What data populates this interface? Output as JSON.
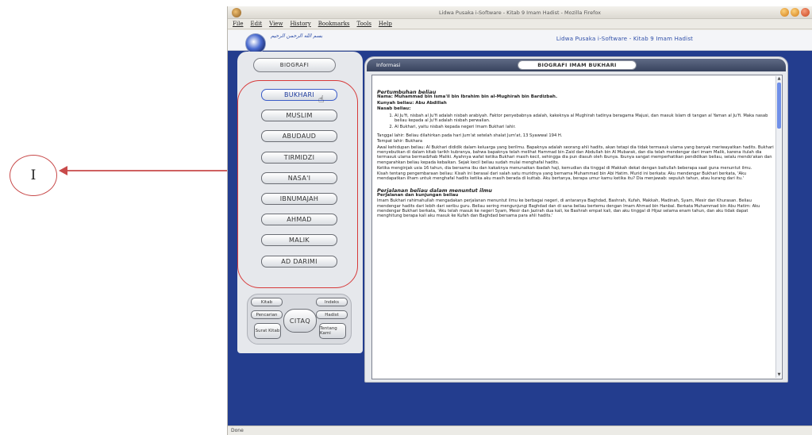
{
  "annotation": {
    "label": "I"
  },
  "window": {
    "title": "Lidwa Pusaka i-Software - Kitab 9 Imam Hadist - Mozilla Firefox",
    "menu": [
      "File",
      "Edit",
      "View",
      "History",
      "Bookmarks",
      "Tools",
      "Help"
    ],
    "status": "Done"
  },
  "app": {
    "arabic_header": "بسم الله الرحمن الرحيم",
    "title": "Lidwa Pusaka i-Software - Kitab 9 Imam Hadist"
  },
  "left_panel": {
    "biografi_label": "BIOGRAFI",
    "books": [
      "BUKHARI",
      "MUSLIM",
      "ABUDAUD",
      "TIRMIDZI",
      "NASA'I",
      "IBNUMAJAH",
      "AHMAD",
      "MALIK",
      "AD DARIMI"
    ],
    "controls": {
      "top_left": "Kitab",
      "top_right": "Indeks",
      "mid_left": "Pencarian",
      "mid_right": "Hadist",
      "bottom_left": "Surat Kitab",
      "bottom_right": "Tentang Kami",
      "center": "CITAQ"
    }
  },
  "right_panel": {
    "tab_label": "Informasi",
    "title": "BIOGRAFI IMAM BUKHARI",
    "content": {
      "heading1": "Pertumbuhan beliau",
      "name_line": "Nama: Muhammad bin Isma'il bin Ibrahim bin al-Mughirah bin Bardizbah.",
      "kunyah_line": "Kunyah beliau: Abu Abdillah",
      "nasab_label": "Nasab beliau:",
      "nasab_items": [
        "Al Ju'fi, nisbah al Ju'fi adalah nisbah arabiyah. Faktor penyebabnya adalah, kakeknya al Mughirah tadinya beragama Majusi, dan masuk Islam di tangan al Yaman al Ju'fi. Maka nasab beliau kepada al Ju'fi adalah nisbah perwalian.",
        "Al Bukhari, yaitu nisbah kepada negeri Imam Bukhari lahir."
      ],
      "para_lahir": "Tanggal lahir: Beliau dilahirkan pada hari Jum'at setelah shalat Jum'at, 13 Syawwal 194 H.",
      "para_tempat": "Tempat lahir: Bukhara",
      "para_awal": "Awal kehidupan beliau: Al Bukhari dididik dalam keluarga yang berilmu. Bapaknya adalah seorang ahli hadits, akan tetapi dia tidak termasuk ulama yang banyak meriwayatkan hadits. Bukhari menyebutkan di dalam kitab tarikh kubranya, bahwa bapaknya telah melihat Hammad bin Zaid dan Abdullah bin Al Mubarak, dan dia telah mendengar dari imam Malik, karena itulah dia termasuk ulama bermadzhab Maliki. Ayahnya wafat ketika Bukhari masih kecil, sehingga dia pun diasuh oleh ibunya. Ibunya sangat memperhatikan pendidikan beliau, selalu mendo'akan dan mengarahkan beliau kepada kebaikan. Sejak kecil beliau sudah mulai menghafal hadits.",
      "para_lanjut": "Ketika menginjak usia 16 tahun, dia bersama ibu dan kakaknya menunaikan ibadah haji, kemudian dia tinggal di Makkah dekat dengan baitullah beberapa saat guna menuntut ilmu.",
      "para_kisah": "Kisah tentang pengembaraan beliau: Kisah ini berasal dari salah satu muridnya yang bernama Muhammad bin Abi Hatim. Murid ini berkata: Aku mendengar Bukhari berkata, 'Aku mendapatkan ilham untuk menghafal hadits ketika aku masih berada di kuttab. Aku bertanya, berapa umur kamu ketika itu? Dia menjawab: sepuluh tahun, atau kurang dari itu.'",
      "heading2": "Perjalanan beliau dalam menuntut ilmu",
      "sub2": "Perjalanan dan kunjungan beliau",
      "para_perjalanan": "Imam Bukhari rahimahullah mengadakan perjalanan menuntut ilmu ke berbagai negeri, di antaranya Baghdad, Bashrah, Kufah, Makkah, Madinah, Syam, Mesir dan Khurasan. Beliau mendengar hadits dari lebih dari seribu guru. Beliau sering mengunjungi Baghdad dan di sana beliau bertemu dengan Imam Ahmad bin Hanbal. Berkata Muhammad bin Abu Hatim: Aku mendengar Bukhari berkata, 'Aku telah masuk ke negeri Syam, Mesir dan Jazirah dua kali, ke Bashrah empat kali, dan aku tinggal di Hijaz selama enam tahun, dan aku tidak dapat menghitung berapa kali aku masuk ke Kufah dan Baghdad bersama para ahli hadits.'"
    }
  }
}
